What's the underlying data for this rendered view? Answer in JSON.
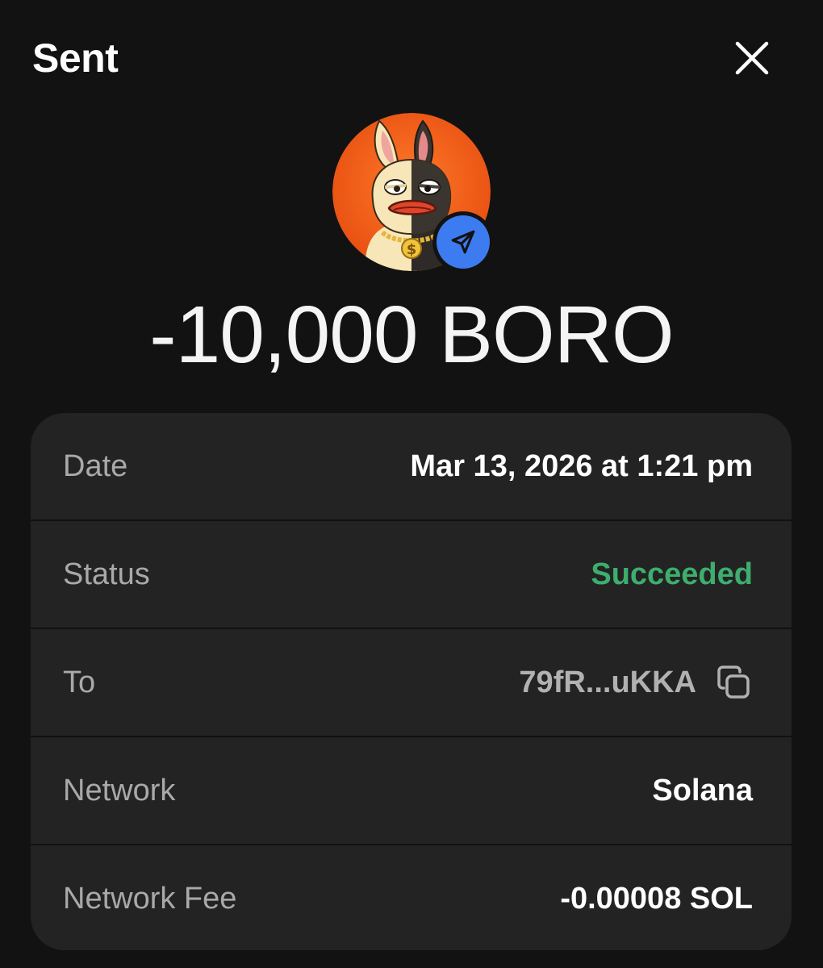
{
  "header": {
    "title": "Sent",
    "close_icon": "close-icon"
  },
  "token": {
    "avatar_icon": "boro-token-avatar",
    "badge_icon": "send-arrow-icon",
    "badge_color": "#3d7cf0",
    "avatar_bg_color": "#f2581c"
  },
  "amount": {
    "text": "-10,000 BORO"
  },
  "details": {
    "date": {
      "label": "Date",
      "value": "Mar 13, 2026 at 1:21 pm"
    },
    "status": {
      "label": "Status",
      "value": "Succeeded",
      "color": "#3dae6e"
    },
    "to": {
      "label": "To",
      "value": "79fR...uKKA",
      "copy_icon": "copy-icon"
    },
    "network": {
      "label": "Network",
      "value": "Solana"
    },
    "fee": {
      "label": "Network Fee",
      "value": "-0.00008 SOL"
    }
  }
}
